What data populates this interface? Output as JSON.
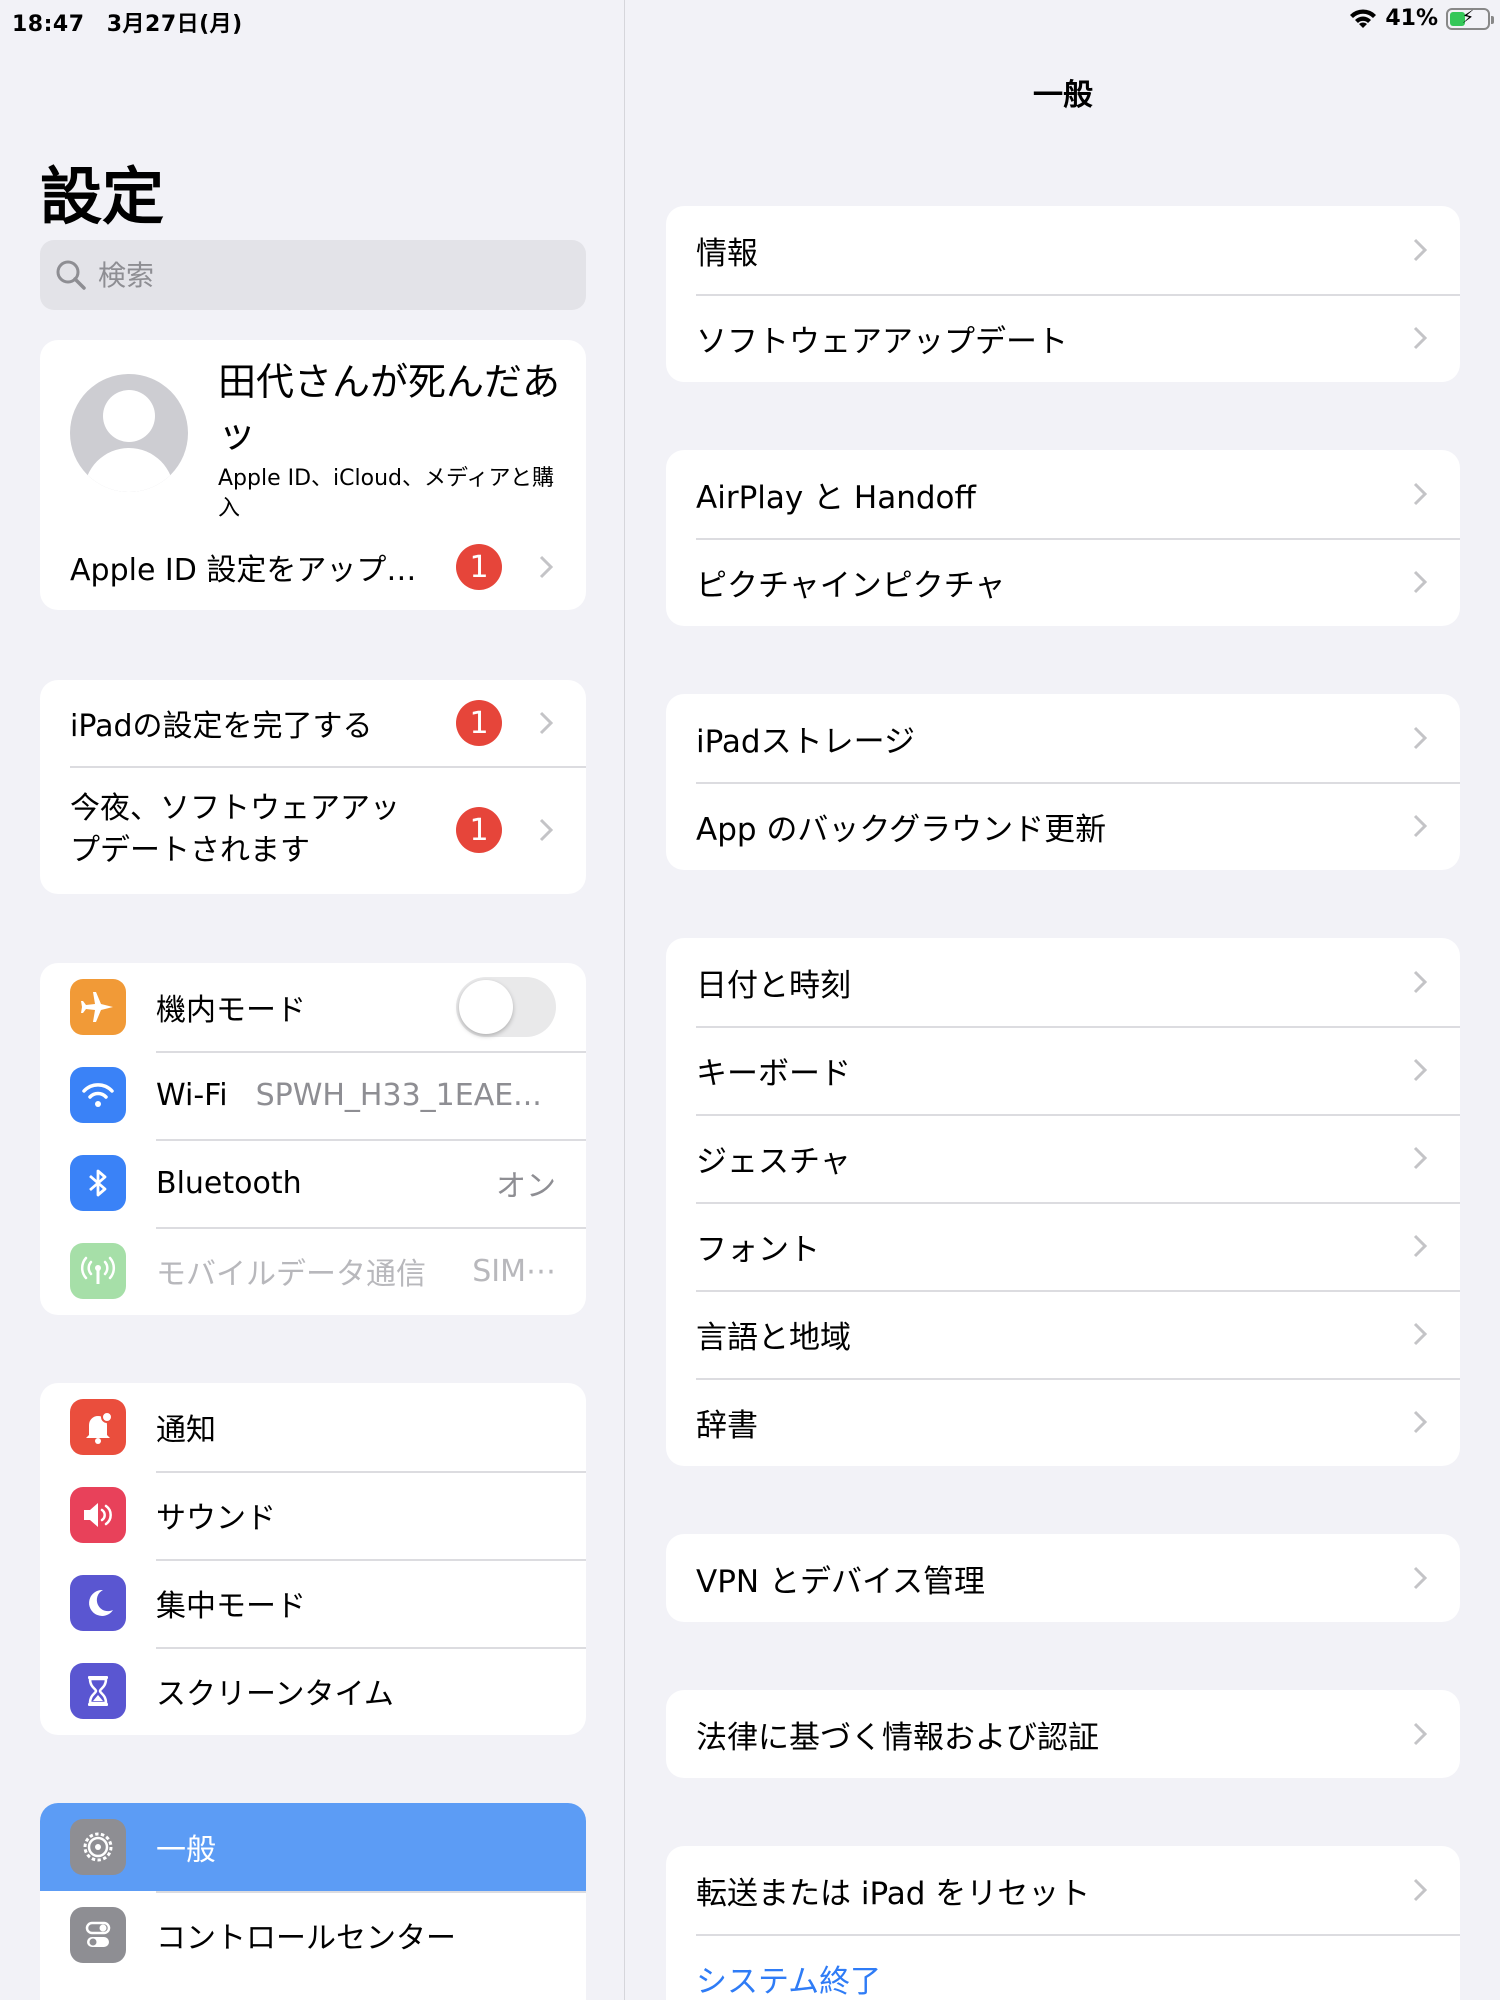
{
  "status_bar": {
    "time": "18:47",
    "date": "3月27日(月)",
    "battery_percent": "41%",
    "battery_level": 0.41
  },
  "master": {
    "title": "設定",
    "search": {
      "placeholder": "検索"
    },
    "profile": {
      "name": "田代さんが死んだあッ",
      "subtitle": "Apple ID、iCloud、メディアと購入"
    },
    "apple_id_update": {
      "label": "Apple ID 設定をアップ…",
      "badge": "1"
    },
    "setup_group": [
      {
        "label": "iPadの設定を完了する",
        "badge": "1"
      },
      {
        "label": "今夜、ソフトウェアアップデートされます",
        "badge": "1"
      }
    ],
    "network_group": [
      {
        "label": "機内モード",
        "icon": "airplane-icon",
        "color": "#f19a37",
        "toggle_on": false
      },
      {
        "label": "Wi-Fi",
        "value": "SPWH_H33_1EAE...",
        "icon": "wifi-icon",
        "color": "#3a82f7"
      },
      {
        "label": "Bluetooth",
        "value": "オン",
        "icon": "bluetooth-icon",
        "color": "#3a82f7"
      },
      {
        "label": "モバイルデータ通信",
        "value": "SIM⋯",
        "icon": "antenna-icon",
        "color": "#a6dfa8",
        "disabled": true
      }
    ],
    "notify_group": [
      {
        "label": "通知",
        "icon": "bell-icon",
        "color": "#ea4e3d"
      },
      {
        "label": "サウンド",
        "icon": "speaker-icon",
        "color": "#e8415a"
      },
      {
        "label": "集中モード",
        "icon": "moon-icon",
        "color": "#5a56d1"
      },
      {
        "label": "スクリーンタイム",
        "icon": "hourglass-icon",
        "color": "#5a56d1"
      }
    ],
    "general_group": [
      {
        "label": "一般",
        "icon": "gear-icon",
        "color": "#8e8e93",
        "selected": true
      },
      {
        "label": "コントロールセンター",
        "icon": "switches-icon",
        "color": "#8e8e93"
      }
    ]
  },
  "detail": {
    "title": "一般",
    "groups": [
      [
        "情報",
        "ソフトウェアアップデート"
      ],
      [
        "AirPlay と Handoff",
        "ピクチャインピクチャ"
      ],
      [
        "iPadストレージ",
        "App のバックグラウンド更新"
      ],
      [
        "日付と時刻",
        "キーボード",
        "ジェスチャ",
        "フォント",
        "言語と地域",
        "辞書"
      ],
      [
        "VPN とデバイス管理"
      ],
      [
        "法律に基づく情報および認証"
      ],
      [
        "転送または iPad をリセット"
      ]
    ],
    "shutdown_label": "システム終了",
    "link_color": "#2f7cf6"
  }
}
